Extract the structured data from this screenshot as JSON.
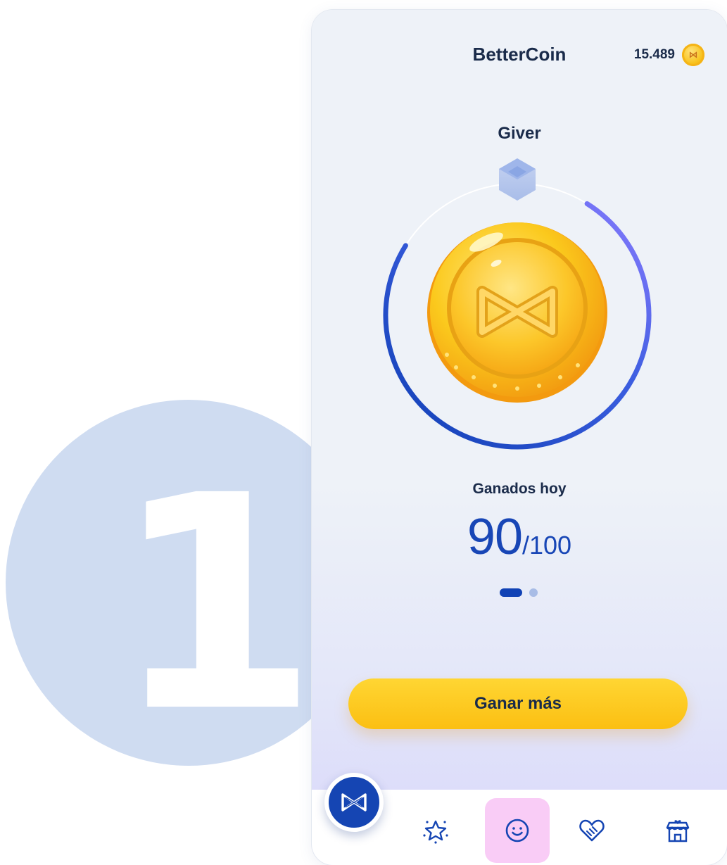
{
  "app": {
    "title": "BetterCoin"
  },
  "balance": {
    "value": "15.489",
    "icon": "coin-icon"
  },
  "level": {
    "name": "Giver",
    "progress": 0.75,
    "icon": "cube-icon"
  },
  "earned_today": {
    "label": "Ganados hoy",
    "value": "90",
    "total": "/100"
  },
  "pager": {
    "pages": 2,
    "active": 1
  },
  "cta": {
    "label": "Ganar más"
  },
  "step": {
    "number": "1"
  },
  "tabs": [
    {
      "icon": "brand-logo-icon",
      "active": false
    },
    {
      "icon": "star-icon",
      "active": false
    },
    {
      "icon": "smile-icon",
      "active": true
    },
    {
      "icon": "handshake-heart-icon",
      "active": false
    },
    {
      "icon": "store-icon",
      "active": false
    }
  ],
  "colors": {
    "accent": "#1545b3",
    "ring_start": "#1142b5",
    "ring_end": "#8176ff",
    "coin": "#f8c21c",
    "cta": "#fbbf12",
    "active_tab": "#f9ccf6",
    "step_badge": "#cfdcf1"
  }
}
